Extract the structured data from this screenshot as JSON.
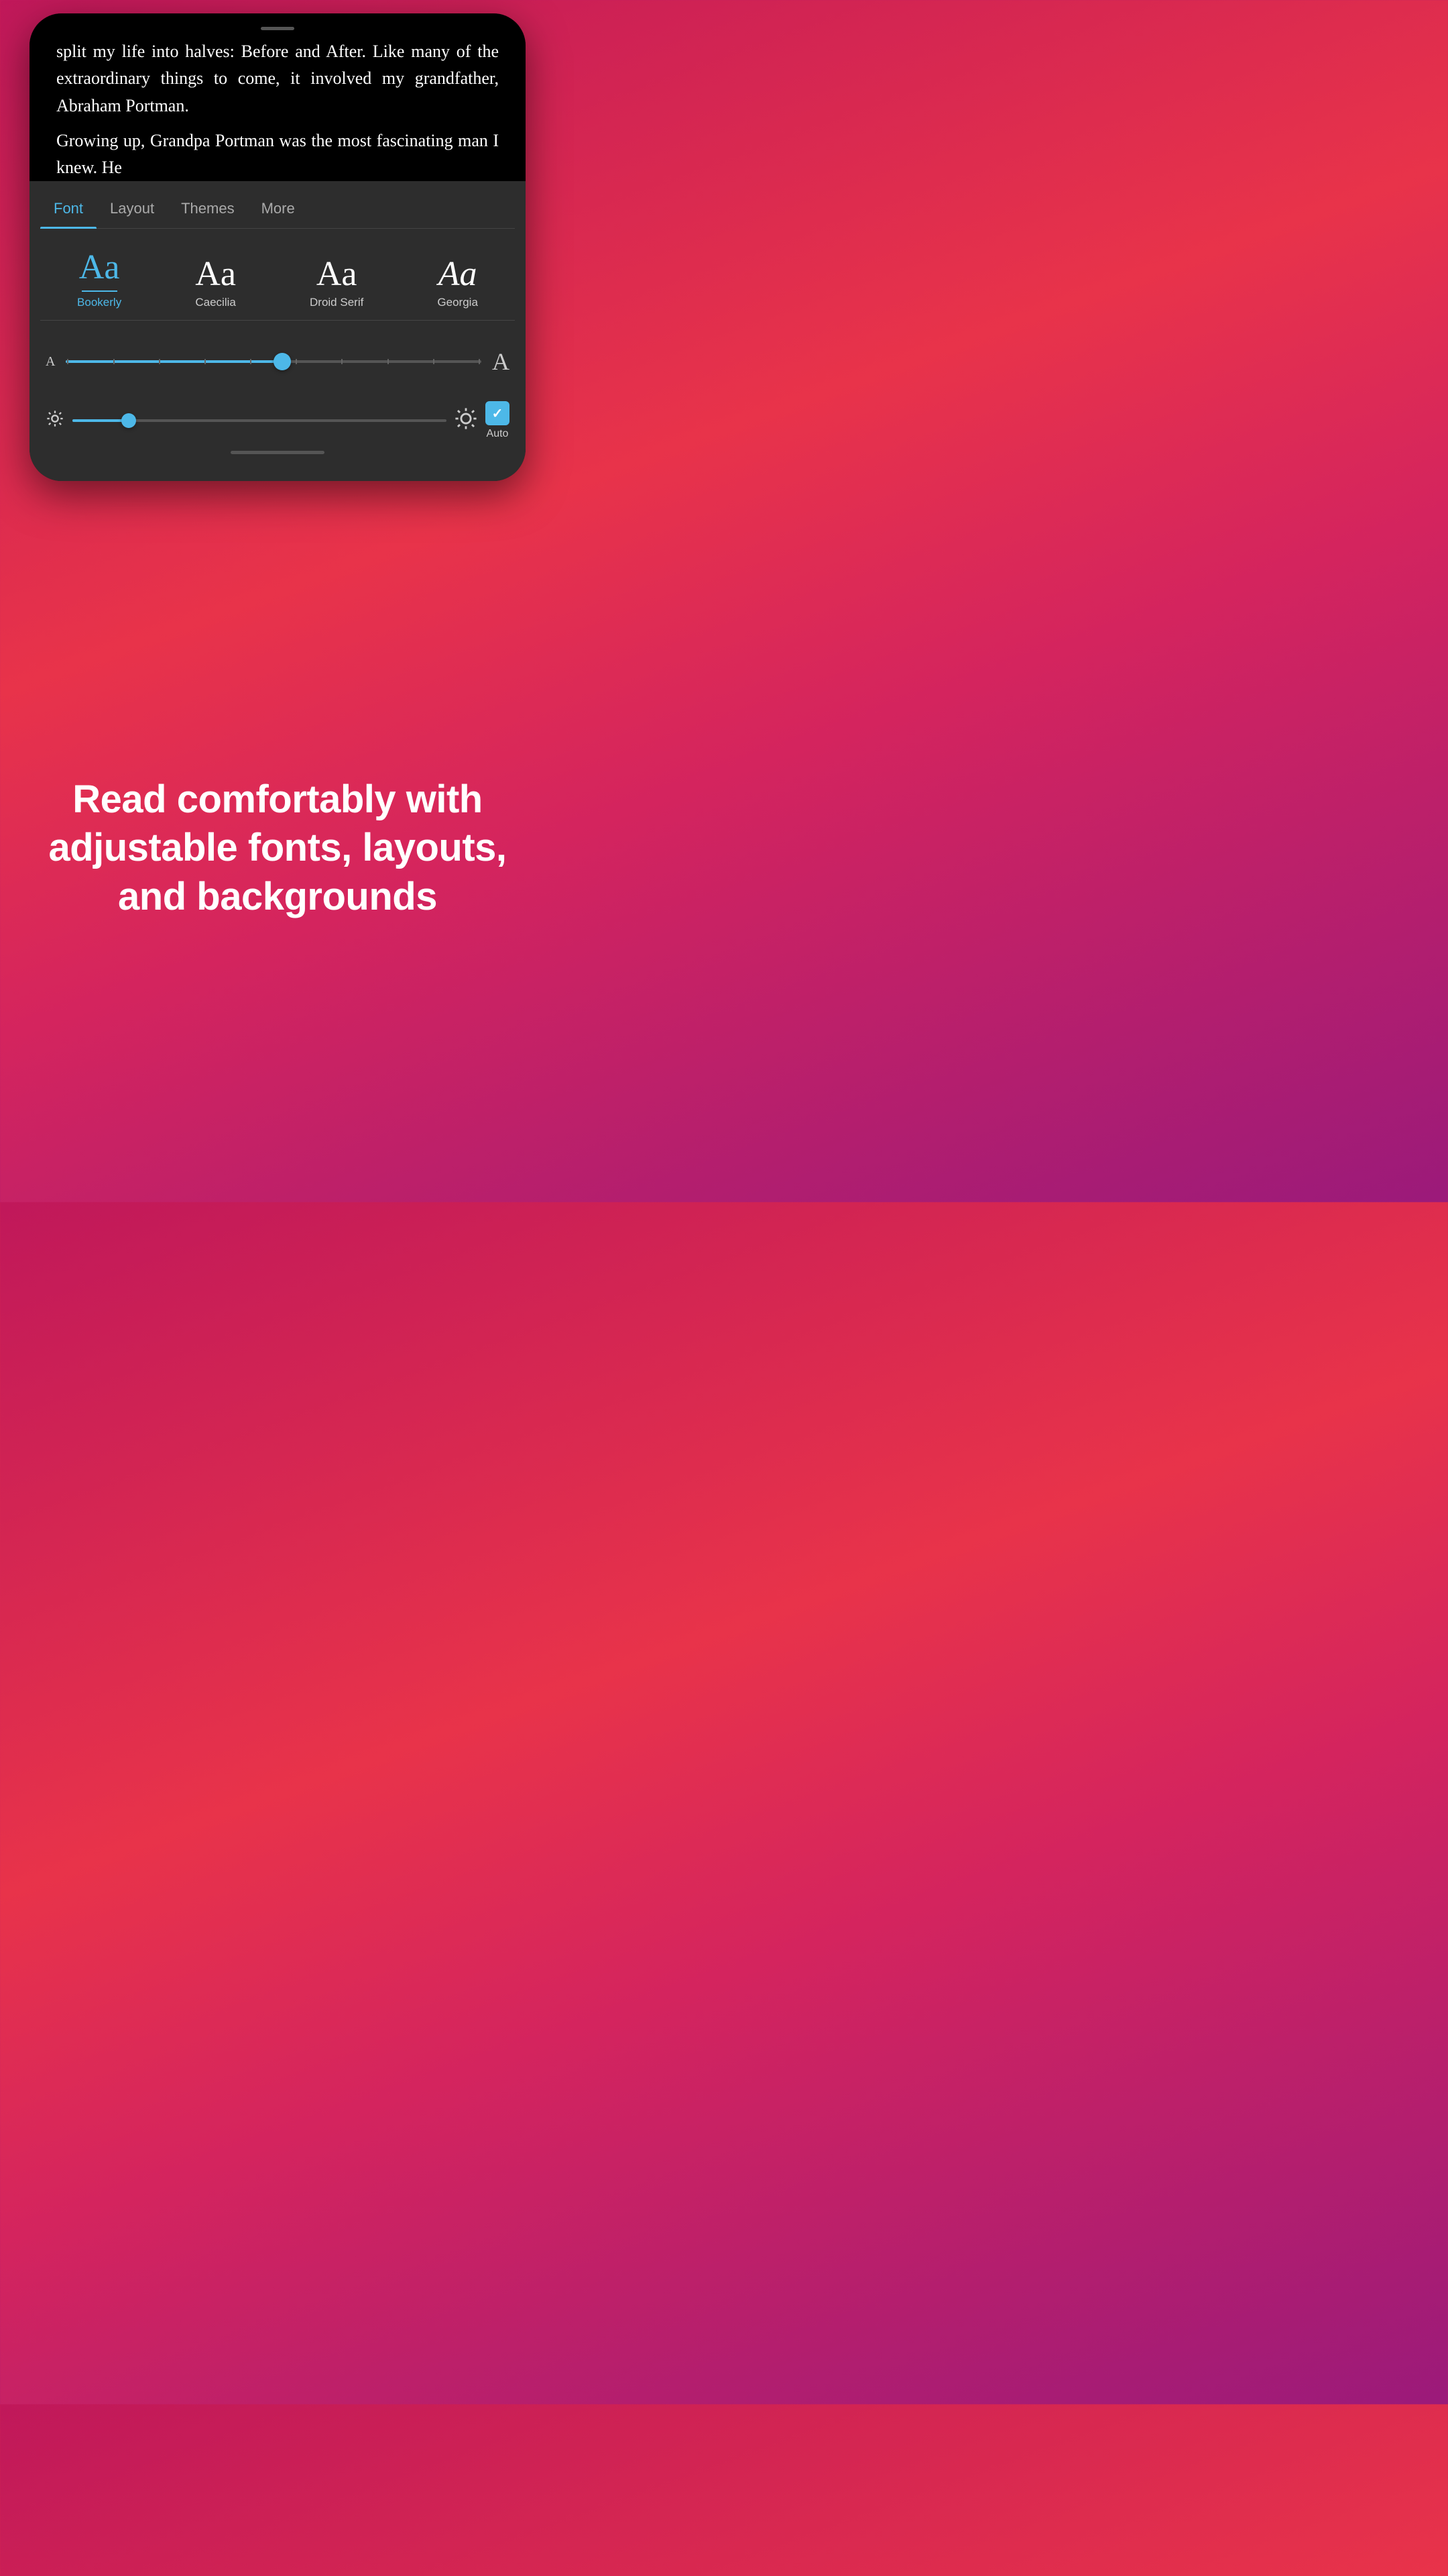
{
  "phone": {
    "book_text": "split my life into halves: Before and After. Like many of the extraordinary things to come, it involved my grandfather, Abraham Portman.",
    "book_text_2": "Growing up, Grandpa Portman was the most fascinating man I knew. He",
    "tabs": [
      {
        "label": "Font",
        "active": true
      },
      {
        "label": "Layout",
        "active": false
      },
      {
        "label": "Themes",
        "active": false
      },
      {
        "label": "More",
        "active": false
      }
    ],
    "fonts": [
      {
        "name": "Bookerly",
        "preview": "Aa",
        "selected": true
      },
      {
        "name": "Caecilia",
        "preview": "Aa",
        "selected": false
      },
      {
        "name": "Droid Serif",
        "preview": "Aa",
        "selected": false
      },
      {
        "name": "Georgia",
        "preview": "Aa",
        "selected": false
      }
    ],
    "font_size": {
      "small_label": "A",
      "large_label": "A",
      "value": 52
    },
    "brightness": {
      "value": 15,
      "auto_label": "Auto"
    }
  },
  "promo": {
    "text": "Read comfortably with adjustable fonts, layouts, and backgrounds"
  }
}
